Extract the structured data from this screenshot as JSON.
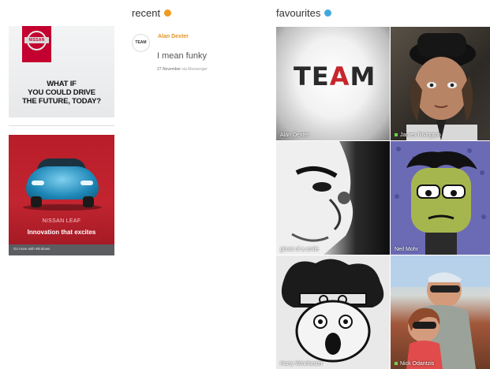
{
  "ads": {
    "top": {
      "logo_text": "NISSAN",
      "headline_lines": [
        "WHAT IF",
        "YOU COULD DRIVE",
        "THE FUTURE, TODAY?"
      ]
    },
    "bottom": {
      "model": "NISSAN LEAF",
      "tagline": "Innovation that excites",
      "footer": "Go more with Windows"
    }
  },
  "recent": {
    "title": "recent",
    "items": [
      {
        "avatar_text": "TEAM",
        "name": "Alan Dexter",
        "message": "I mean funky",
        "date": "27 November",
        "via": "via Messenger"
      }
    ]
  },
  "favourites": {
    "title": "favourites",
    "tiles": [
      {
        "name": "Alan Dexter",
        "online": false,
        "image_text": "TEAM"
      },
      {
        "name": "James Rivington",
        "online": true
      },
      {
        "name": "ghost of a smile",
        "online": false
      },
      {
        "name": "Neil Mohr",
        "online": false
      },
      {
        "name": "Harry Winchester",
        "online": false
      },
      {
        "name": "Nick Odantzis",
        "online": true
      }
    ]
  },
  "colors": {
    "recent_accent": "#f09a1e",
    "favourites_accent": "#42a7dd",
    "nissan_red": "#c3002f"
  }
}
